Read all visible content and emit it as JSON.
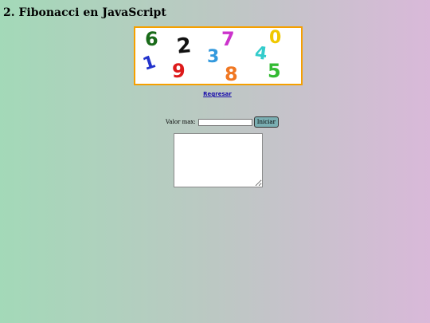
{
  "page": {
    "title": "2. Fibonacci en JavaScript"
  },
  "banner": {
    "digits": [
      {
        "text": "6",
        "color": "#1a6b1a"
      },
      {
        "text": "2",
        "color": "#111111"
      },
      {
        "text": "7",
        "color": "#cc33cc"
      },
      {
        "text": "0",
        "color": "#f0c800"
      },
      {
        "text": "1",
        "color": "#2233cc"
      },
      {
        "text": "9",
        "color": "#dd1a1a"
      },
      {
        "text": "3",
        "color": "#3399dd"
      },
      {
        "text": "4",
        "color": "#33cccc"
      },
      {
        "text": "8",
        "color": "#f07722"
      },
      {
        "text": "5",
        "color": "#33bb33"
      }
    ],
    "border_color": "#f5a000"
  },
  "nav": {
    "back_label": "Regresar"
  },
  "form": {
    "max_label": "Valor max:",
    "max_value": "",
    "start_label": "Iniciar"
  },
  "output": {
    "value": ""
  },
  "colors": {
    "background_left": "#a3d9b8",
    "background_right": "#d9b9d9",
    "button": "#7aaeb2",
    "link": "#1a0dab"
  }
}
